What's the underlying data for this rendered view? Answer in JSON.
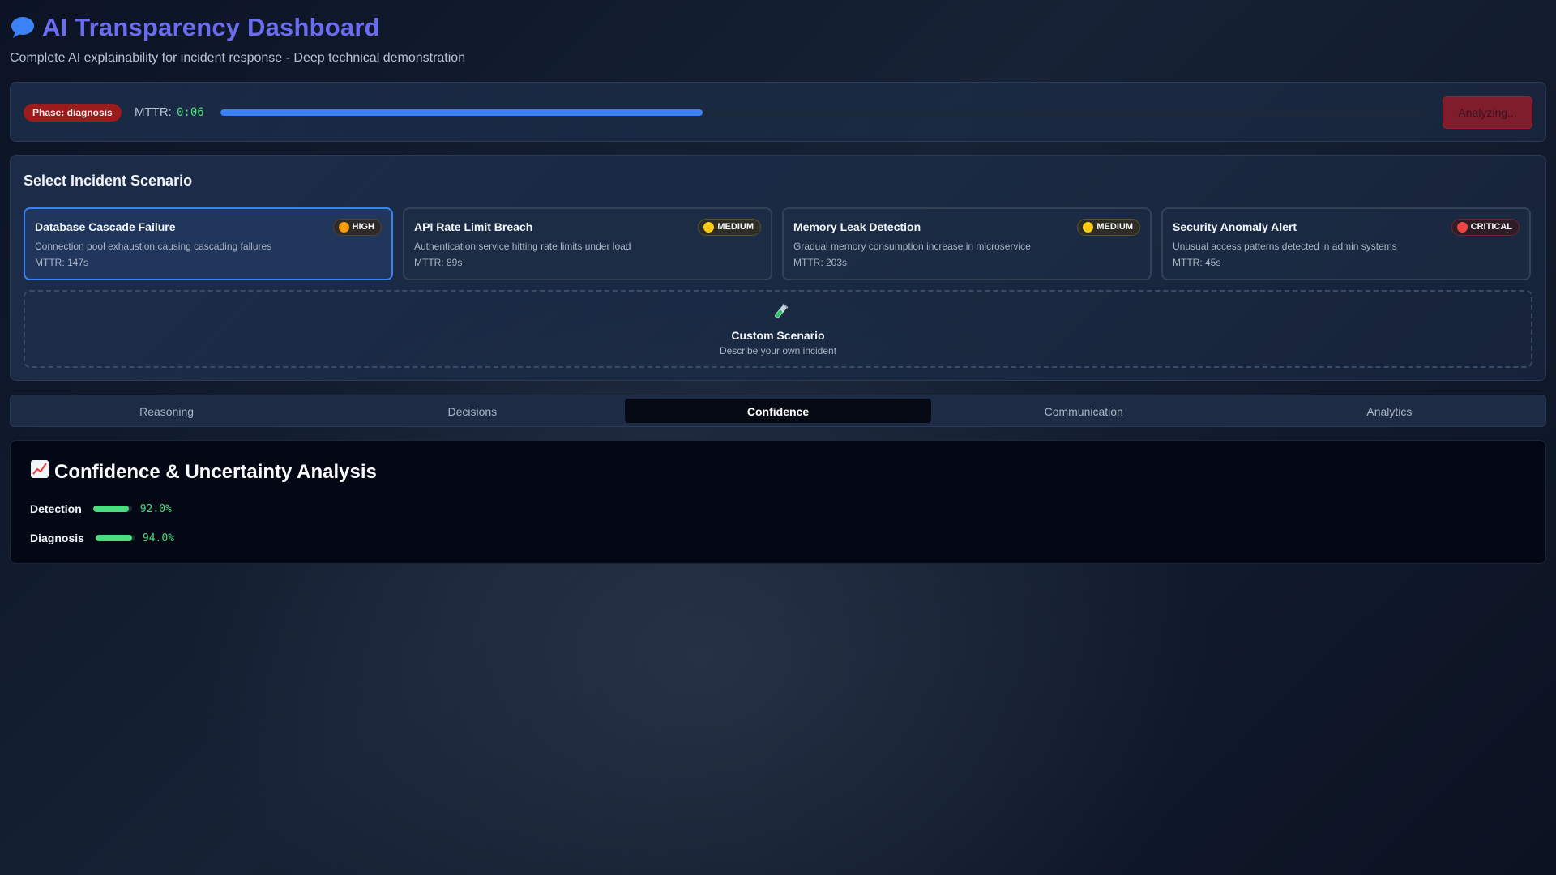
{
  "header": {
    "title_icon": "speech-bubble-icon",
    "title": "AI Transparency Dashboard",
    "subtitle": "Complete AI explainability for incident response - Deep technical demonstration"
  },
  "status": {
    "phase_badge": "Phase: diagnosis",
    "mttr_label": "MTTR:",
    "mttr_value": "0:06",
    "progress_fraction": 0.4,
    "action_button": "Analyzing..."
  },
  "scenarios": {
    "title": "Select Incident Scenario",
    "cards": [
      {
        "title": "Database Cascade Failure",
        "severity": "HIGH",
        "severity_color": "#f59e0b",
        "description": "Connection pool exhaustion causing cascading failures",
        "mttr": "MTTR: 147s",
        "selected": true
      },
      {
        "title": "API Rate Limit Breach",
        "severity": "MEDIUM",
        "severity_color": "#facc15",
        "description": "Authentication service hitting rate limits under load",
        "mttr": "MTTR: 89s",
        "selected": false
      },
      {
        "title": "Memory Leak Detection",
        "severity": "MEDIUM",
        "severity_color": "#facc15",
        "description": "Gradual memory consumption increase in microservice",
        "mttr": "MTTR: 203s",
        "selected": false
      },
      {
        "title": "Security Anomaly Alert",
        "severity": "CRITICAL",
        "severity_color": "#ef4444",
        "description": "Unusual access patterns detected in admin systems",
        "mttr": "MTTR: 45s",
        "selected": false
      }
    ],
    "custom": {
      "icon": "test-tube-icon",
      "title": "Custom Scenario",
      "description": "Describe your own incident"
    }
  },
  "tabs": [
    {
      "label": "Reasoning",
      "active": false
    },
    {
      "label": "Decisions",
      "active": false
    },
    {
      "label": "Confidence",
      "active": true
    },
    {
      "label": "Communication",
      "active": false
    },
    {
      "label": "Analytics",
      "active": false
    }
  ],
  "confidence_panel": {
    "icon": "chart-increasing-icon",
    "title": "Confidence & Uncertainty Analysis",
    "metrics": [
      {
        "label": "Detection",
        "value": "92.0%",
        "fraction": 0.92
      },
      {
        "label": "Diagnosis",
        "value": "94.0%",
        "fraction": 0.94
      }
    ]
  },
  "colors": {
    "accent": "#6b6cf0",
    "progress": "#3b82f6",
    "success": "#4ade80",
    "danger": "#9b1c1c"
  }
}
